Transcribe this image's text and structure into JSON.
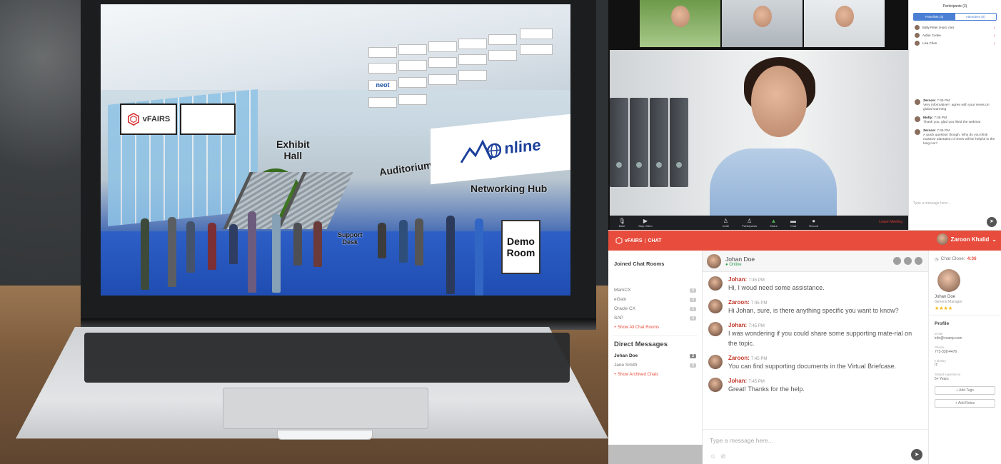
{
  "venue": {
    "logo_text": "vFAIRS",
    "signs": {
      "exhibit_hall": [
        "Exhibit",
        "Hall"
      ],
      "auditorium": "Auditorium",
      "networking_hub": "Networking Hub",
      "support_desk": [
        "Support",
        "Desk"
      ],
      "demo_room": [
        "Demo",
        "Room"
      ]
    },
    "online_banner": "nline",
    "sponsors": [
      "",
      "",
      "",
      "",
      "",
      "",
      "",
      "",
      "",
      "",
      "",
      "",
      "",
      "neot",
      "",
      "",
      "",
      "",
      "",
      "",
      "",
      "",
      ""
    ]
  },
  "video_call": {
    "participants_title": "Participants (3)",
    "tabs": [
      "Panelists (3)",
      "Attendees (0)"
    ],
    "participants": [
      "Bally Peter (Host, me)",
      "Aidan Cooke",
      "Lisa Chen"
    ],
    "messages": [
      {
        "name": "Zeroon:",
        "time": "7:45 PM",
        "text": "Very informative! I agree with your views on global warming"
      },
      {
        "name": "Molly:",
        "time": "7:45 PM",
        "text": "Thank you, glad you liked the webinar"
      },
      {
        "name": "Zeroon:",
        "time": "7:45 PM",
        "text": "A quick question though. Why do you think massive plantation of trees will be helpful in the long run?"
      }
    ],
    "message_placeholder": "Type a message here...",
    "toolbar": [
      "Mute",
      "Stop Video",
      "Invite",
      "Participants",
      "Share",
      "Chat",
      "Record"
    ],
    "leave_label": "Leave Meeting"
  },
  "chat_app": {
    "brand": "vFAIRS",
    "section": "CHAT",
    "current_user": "Zaroon Khalid",
    "joined_rooms_title": "Joined Chat Rooms",
    "rooms": [
      {
        "name": "MarkCX",
        "count": "0"
      },
      {
        "name": "eGain",
        "count": "0"
      },
      {
        "name": "Oracle CX",
        "count": "0"
      },
      {
        "name": "SAP",
        "count": "0"
      }
    ],
    "show_all_rooms": "+ Show All Chat Rooms",
    "direct_messages_title": "Direct Messages",
    "dms": [
      {
        "name": "Johan Doe",
        "count": "2"
      },
      {
        "name": "Jane Smith",
        "count": "0"
      }
    ],
    "show_archived": "+ Show Archived Chats",
    "conversation": {
      "name": "Johan Doe",
      "status": "Online",
      "messages": [
        {
          "name": "Johan:",
          "time": "7:45 PM",
          "text": "Hi, I woud need some assistance."
        },
        {
          "name": "Zaroon:",
          "time": "7:45 PM",
          "text": "Hi Johan, sure, is there anything specific you want to know?"
        },
        {
          "name": "Johan:",
          "time": "7:45 PM",
          "text": "I was wondering if you could share some supporting mate-rial on the topic."
        },
        {
          "name": "Zaroon:",
          "time": "7:45 PM",
          "text": "You can find supporting documents in the Virtual Briefcase."
        },
        {
          "name": "Johan:",
          "time": "7:45 PM",
          "text": "Great! Thanks for the help."
        }
      ]
    },
    "message_placeholder": "Type a message here...",
    "profile": {
      "chat_close_label": "Chat Close:",
      "chat_close_time": "4:36",
      "name": "Johan Doe",
      "title": "General Manager",
      "rating": "★★★★",
      "section": "Profile",
      "fields": [
        {
          "label": "Email",
          "value": "info@vcamp.com"
        },
        {
          "label": "Phone",
          "value": "773-338-4476"
        },
        {
          "label": "Industry",
          "value": "IT"
        },
        {
          "label": "Stated experience",
          "value": "6+ Years"
        }
      ],
      "buttons": [
        "+ Add Tags",
        "+ Add Notes"
      ]
    }
  },
  "colors": {
    "chat_accent": "#e74c3c",
    "floor_blue": "#2a55b8"
  }
}
